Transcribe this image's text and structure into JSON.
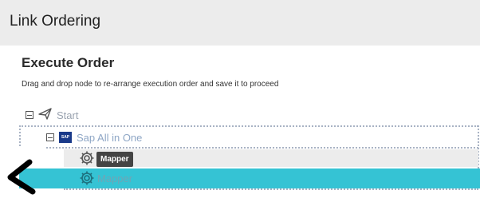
{
  "header": {
    "title": "Link Ordering"
  },
  "panel": {
    "title": "Execute Order",
    "instructions": "Drag and drop node to re-arrange execution order and save it to proceed"
  },
  "tree": {
    "start": {
      "label": "Start",
      "icon": "navigation-arrow-icon"
    },
    "sap": {
      "label": "Sap All in One",
      "badge": "SAP"
    },
    "mapper_hover": {
      "icon": "gear-icon",
      "tooltip": "Mapper"
    },
    "mapper_selected": {
      "label": "Mapper",
      "icon": "gear-icon"
    }
  },
  "colors": {
    "header_bg": "#ececec",
    "selected_row": "#35c3d4",
    "tooltip_bg": "#444444",
    "sap_badge": "#1a3a8a"
  }
}
